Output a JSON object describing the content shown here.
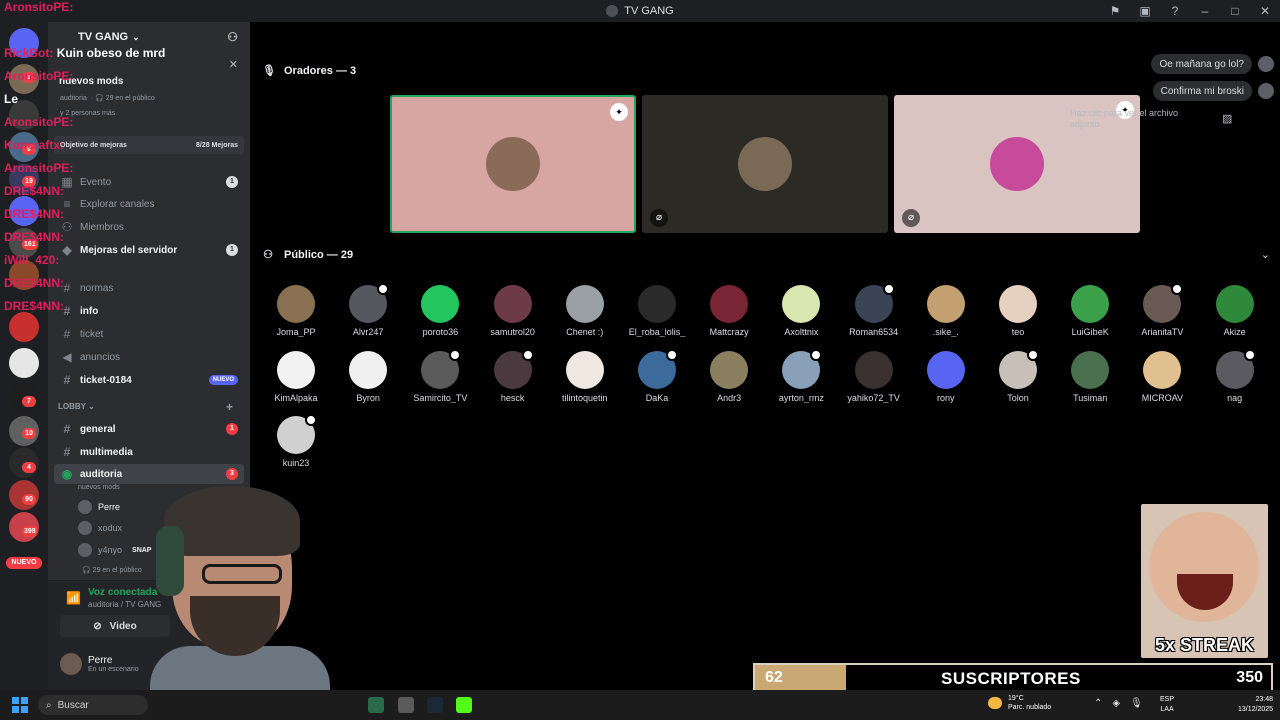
{
  "window": {
    "title": "TV GANG"
  },
  "chat_overlay": [
    {
      "user": "AronsitoPE:",
      "message": ""
    },
    {
      "user": "",
      "message": ""
    },
    {
      "user": "RickBot:",
      "message": "Kuin obeso de mrd"
    },
    {
      "user": "AronsitoPE:",
      "message": ""
    },
    {
      "user": "",
      "message": "Le"
    },
    {
      "user": "AronsitoPE:",
      "message": ""
    },
    {
      "user": "Kuncraftx:",
      "message": ""
    },
    {
      "user": "AronsitoPE:",
      "message": ""
    },
    {
      "user": "DRE$4NN:",
      "message": ""
    },
    {
      "user": "DRE$4NN:",
      "message": ""
    },
    {
      "user": "DRE$4NN:",
      "message": ""
    },
    {
      "user": "iWill_420:",
      "message": ""
    },
    {
      "user": "DRE$4NN:",
      "message": ""
    },
    {
      "user": "DRE$4NN:",
      "message": ""
    }
  ],
  "rail": {
    "badges": [
      "1",
      "9",
      "19",
      "161",
      "7",
      "10",
      "4",
      "90",
      "398"
    ],
    "new_label": "NUEVO"
  },
  "sidebar": {
    "server_name": "TV GANG",
    "event": {
      "title": "nuevos mods",
      "channel": "auditoria",
      "listeners": "29 en el público",
      "others": "y 2 personas más"
    },
    "boost": {
      "label": "Objetivo de mejoras",
      "progress": "8/28 Mejoras"
    },
    "rows": [
      {
        "label": "Evento",
        "count": "1"
      },
      {
        "label": "Explorar canales",
        "count": ""
      },
      {
        "label": "Miembros",
        "count": ""
      },
      {
        "label": "Mejoras del servidor",
        "count": "1"
      }
    ],
    "channels": [
      {
        "name": "normas"
      },
      {
        "name": "info"
      },
      {
        "name": "ticket"
      },
      {
        "name": "anuncios"
      },
      {
        "name": "ticket-0184",
        "tag": "NUEVO"
      }
    ],
    "category": "LOBBY",
    "lobby_channels": [
      {
        "name": "general",
        "count": "1"
      },
      {
        "name": "multimedia",
        "count": ""
      },
      {
        "name": "auditoria",
        "count": "3"
      }
    ],
    "stage_topic": "nuevos mods",
    "voice_users": [
      {
        "name": "Perre"
      },
      {
        "name": "xodux"
      },
      {
        "name": "y4nyo",
        "tag": "SNAP"
      }
    ],
    "listeners": "29 en el público",
    "voice_panel": {
      "status": "Voz conectada",
      "channel": "auditoria / TV GANG",
      "video_label": "Video",
      "user_name": "Perre",
      "user_status": "En un escenario"
    }
  },
  "stage": {
    "speakers_header": "Oradores — 3",
    "audience_header": "Público — 29",
    "attach_hint": "Haz clic para ver el archivo adjunto",
    "chips": [
      "Oe mañana go lol?",
      "Confirma mi broski"
    ],
    "audience": [
      "Joma_PP",
      "Alvr247",
      "poroto36",
      "samutrol20",
      "Chenet :)",
      "El_roba_lolis_",
      "Mattcrazy",
      "Axolttnix",
      "Roman6534",
      ".sike_.",
      "teo",
      "LuiGibeK",
      "ArianitaTV",
      "Akize",
      "KimAlpaka",
      "Byron",
      "Samircito_TV",
      "hesck",
      "tilintoquetin",
      "DaKa",
      "Andr3",
      "ayrton_rmz",
      "yahiko72_TV",
      "rony",
      "Tolon",
      "Tusiman",
      "MICROAV",
      "nag",
      "kuin23"
    ],
    "audience_colors": [
      "#8a7052",
      "#55595f",
      "#22c55e",
      "#6d3a4a",
      "#9aa0a6",
      "#2a2a2a",
      "#7a2535",
      "#d8e6b0",
      "#3a4454",
      "#c4a070",
      "#e6d0c0",
      "#3aa04a",
      "#6a5a55",
      "#2e8a3a",
      "#f2f2f2",
      "#f0f0f0",
      "#5a5a5a",
      "#4a3a40",
      "#f0e8e0",
      "#3c6a9a",
      "#8a8060",
      "#8aa0b8",
      "#3a3030",
      "#5865f2",
      "#c8c0b8",
      "#4a7050",
      "#e0c090",
      "#5a5a60",
      "#d0d0d0"
    ]
  },
  "overlay": {
    "streak_text": "5x STREAK",
    "subs_current": "62",
    "subs_label": "SUSCRIPTORES",
    "subs_goal": "350",
    "subs_fraction": 0.177
  },
  "taskbar": {
    "search_label": "Buscar",
    "temp": "19°C",
    "weather": "Parc. nublado",
    "lang1": "ESP",
    "lang2": "LAA",
    "time": "23:48",
    "date": "13/12/2025"
  }
}
